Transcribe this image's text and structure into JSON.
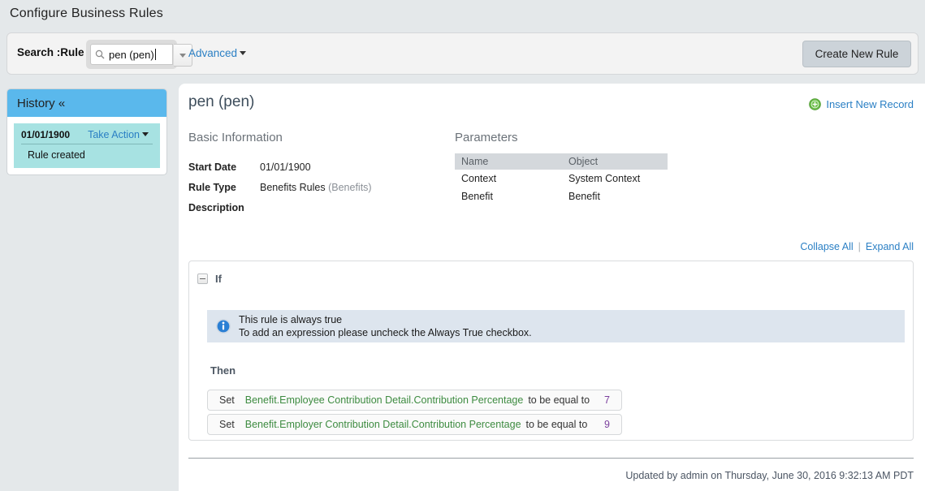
{
  "page": {
    "title": "Configure Business Rules"
  },
  "search": {
    "label": "Search :Rule",
    "value": "pen (pen)",
    "placeholder": "Search",
    "icons": {
      "magnifier": "search-icon",
      "dropdown": "chevron-down-icon"
    },
    "advanced_label": "Advanced",
    "create_button_label": "Create New Rule"
  },
  "history": {
    "header": "History «",
    "entries": [
      {
        "date": "01/01/1900",
        "action_label": "Take Action",
        "description": "Rule created"
      }
    ]
  },
  "record": {
    "title": "pen (pen)",
    "insert_new_record_label": "Insert New Record",
    "insert_icon": "add-circle-icon",
    "basic_information": {
      "heading": "Basic Information",
      "fields": [
        {
          "label": "Start Date",
          "value": "01/01/1900",
          "suffix": ""
        },
        {
          "label": "Rule Type",
          "value": "Benefits Rules",
          "suffix": "(Benefits)"
        },
        {
          "label": "Description",
          "value": "",
          "suffix": ""
        }
      ]
    },
    "parameters": {
      "heading": "Parameters",
      "columns": [
        "Name",
        "Object"
      ],
      "rows": [
        [
          "Context",
          "System Context"
        ],
        [
          "Benefit",
          "Benefit"
        ]
      ]
    }
  },
  "rule_editor": {
    "collapse_all_label": "Collapse All",
    "expand_all_label": "Expand All",
    "divider": "|",
    "if_label": "If",
    "if_toggle_icon": "minus-box-icon",
    "info": {
      "icon": "info-icon",
      "line1": "This rule is always true",
      "line2": "To add an expression please uncheck the Always True checkbox."
    },
    "then_label": "Then",
    "actions": [
      {
        "verb": "Set",
        "field": "Benefit.Employee Contribution Detail.Contribution Percentage",
        "operator": "to be equal to",
        "value": "7"
      },
      {
        "verb": "Set",
        "field": "Benefit.Employer Contribution Detail.Contribution Percentage",
        "operator": "to be equal to",
        "value": "9"
      }
    ]
  },
  "footer": {
    "updated_text": "Updated by admin on Thursday, June 30, 2016 9:32:13 AM PDT"
  },
  "colors": {
    "page_background": "#e4e8ea",
    "history_header": "#5ab8ec",
    "history_entry": "#a7e2e2",
    "link_blue": "#2a7fc4",
    "field_green": "#3d8b40",
    "value_purple": "#7b3f9d",
    "info_box": "#dde5ee"
  }
}
